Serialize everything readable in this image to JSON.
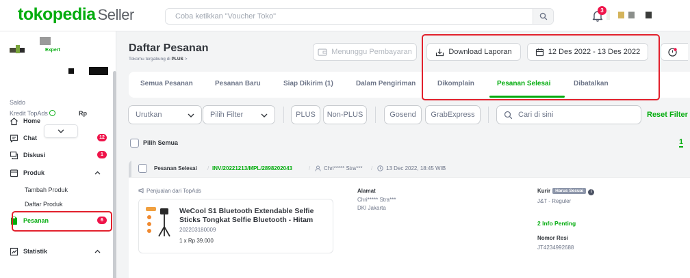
{
  "header": {
    "logo_text": "tokopedia",
    "logo_suffix": "Seller",
    "search_placeholder": "Coba ketikkan \"Voucher Toko\"",
    "notification_count": "3"
  },
  "sidebar": {
    "tier": "Expert",
    "saldo_label": "Saldo",
    "kredit_label": "Kredit TopAds",
    "kredit_value": "Rp",
    "items": [
      {
        "label": "Home"
      },
      {
        "label": "Chat",
        "badge": "12"
      },
      {
        "label": "Diskusi",
        "badge": "1"
      },
      {
        "label": "Produk"
      },
      {
        "label": "Pesanan",
        "badge": "6"
      },
      {
        "label": "Statistik"
      }
    ],
    "produk_sub": [
      "Tambah Produk",
      "Daftar Produk"
    ]
  },
  "main": {
    "title": "Daftar Pesanan",
    "subtitle_prefix": "Tokomu tergabung di",
    "subtitle_plan": "PLUS",
    "subtitle_arrow": ">",
    "menunggu_button": "Menunggu Pembayaran",
    "download_button": "Download Laporan",
    "date_range": "12 Des 2022 - 13 Des 2022",
    "tabs": [
      {
        "label": "Semua Pesanan"
      },
      {
        "label": "Pesanan Baru"
      },
      {
        "label": "Siap Dikirim (1)"
      },
      {
        "label": "Dalam Pengiriman"
      },
      {
        "label": "Dikomplain"
      },
      {
        "label": "Pesanan Selesai",
        "active": true
      },
      {
        "label": "Dibatalkan"
      }
    ],
    "filters": {
      "sort_label": "Urutkan",
      "filter_label": "Pilih Filter",
      "chips": [
        "PLUS",
        "Non-PLUS",
        "Gosend",
        "GrabExpress"
      ],
      "search_placeholder": "Cari di sini",
      "reset_label": "Reset Filter"
    },
    "select_all_label": "Pilih Semua",
    "page_number": "1",
    "order": {
      "status": "Pesanan Selesai",
      "invoice": "INV/20221213/MPL/2898202043",
      "buyer": "Chri***** Stra***",
      "datetime": "13 Dec 2022, 18:45 WIB",
      "source_label": "Penjualan dari TopAds",
      "product_name": "WeCool S1 Bluetooth Extendable Selfie Sticks Tongkat Selfie Bluetooth - Hitam",
      "product_sku": "202203180009",
      "product_qty_price": "1 x Rp 39.000",
      "alamat_label": "Alamat",
      "alamat_name": "Chri***** Stra***",
      "alamat_city": "DKI Jakarta",
      "kurir_label": "Kurir",
      "kurir_tag": "Harus Sesuai",
      "kurir_value": "J&T - Reguler",
      "info_penting": "2 Info Penting",
      "resi_label": "Nomor Resi",
      "resi_value": "JT4234992688"
    }
  },
  "colors": {
    "brand_green": "#03ac0e",
    "badge_red": "#ef144a",
    "annotation_red": "#e2202c"
  }
}
